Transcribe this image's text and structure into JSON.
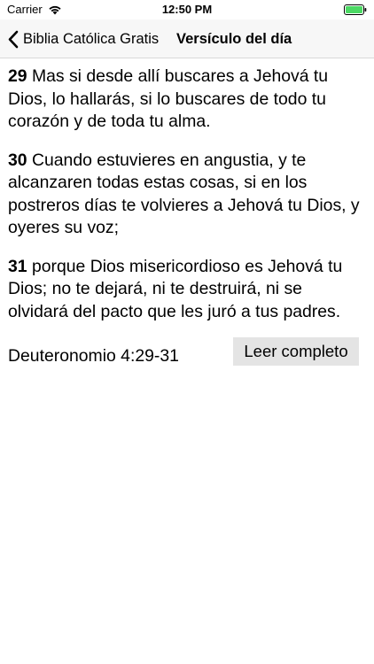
{
  "status_bar": {
    "carrier": "Carrier",
    "time": "12:50 PM"
  },
  "nav": {
    "back_label": "Biblia Católica Gratis",
    "title": "Versículo del día"
  },
  "verses": [
    {
      "number": "29",
      "text": " Mas si desde allí buscares a Jehová tu Dios, lo hallarás, si lo buscares de todo tu corazón y de toda tu alma."
    },
    {
      "number": "30",
      "text": " Cuando estuvieres en angustia, y te alcanzaren todas estas cosas, si en los postreros días te volvieres a Jehová tu Dios, y oyeres su voz;"
    },
    {
      "number": "31",
      "text": " porque Dios misericordioso es Jehová tu Dios; no te dejará, ni te destruirá, ni se olvidará del pacto que les juró a tus padres."
    }
  ],
  "reference": "Deuteronomio 4:29-31",
  "read_button_label": "Leer completo",
  "colors": {
    "nav_background": "#f7f7f7",
    "button_background": "#e4e4e4",
    "battery_fill": "#4cd964"
  }
}
